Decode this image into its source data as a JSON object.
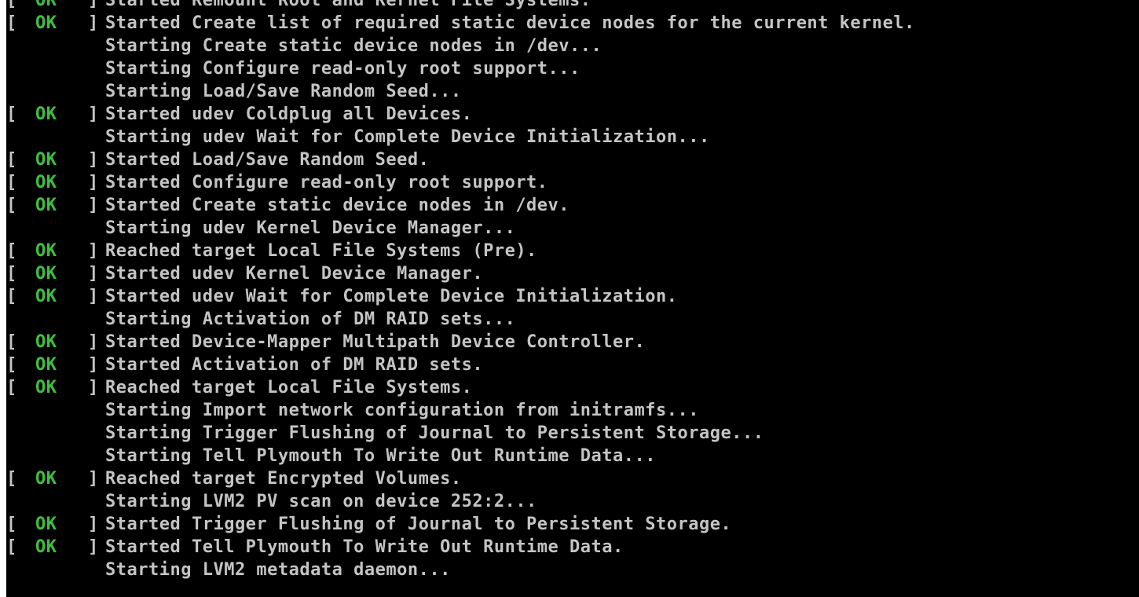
{
  "console": {
    "status_label": "OK",
    "bracket_open": "[",
    "bracket_close": "]",
    "lines": [
      {
        "status": "ok",
        "text": "Started Remount Root and Kernel File Systems."
      },
      {
        "status": "ok",
        "text": "Started Create list of required static device nodes for the current kernel."
      },
      {
        "status": "none",
        "text": "Starting Create static device nodes in /dev..."
      },
      {
        "status": "none",
        "text": "Starting Configure read-only root support..."
      },
      {
        "status": "none",
        "text": "Starting Load/Save Random Seed..."
      },
      {
        "status": "ok",
        "text": "Started udev Coldplug all Devices."
      },
      {
        "status": "none",
        "text": "Starting udev Wait for Complete Device Initialization..."
      },
      {
        "status": "ok",
        "text": "Started Load/Save Random Seed."
      },
      {
        "status": "ok",
        "text": "Started Configure read-only root support."
      },
      {
        "status": "ok",
        "text": "Started Create static device nodes in /dev."
      },
      {
        "status": "none",
        "text": "Starting udev Kernel Device Manager..."
      },
      {
        "status": "ok",
        "text": "Reached target Local File Systems (Pre)."
      },
      {
        "status": "ok",
        "text": "Started udev Kernel Device Manager."
      },
      {
        "status": "ok",
        "text": "Started udev Wait for Complete Device Initialization."
      },
      {
        "status": "none",
        "text": "Starting Activation of DM RAID sets..."
      },
      {
        "status": "ok",
        "text": "Started Device-Mapper Multipath Device Controller."
      },
      {
        "status": "ok",
        "text": "Started Activation of DM RAID sets."
      },
      {
        "status": "ok",
        "text": "Reached target Local File Systems."
      },
      {
        "status": "none",
        "text": "Starting Import network configuration from initramfs..."
      },
      {
        "status": "none",
        "text": "Starting Trigger Flushing of Journal to Persistent Storage..."
      },
      {
        "status": "none",
        "text": "Starting Tell Plymouth To Write Out Runtime Data..."
      },
      {
        "status": "ok",
        "text": "Reached target Encrypted Volumes."
      },
      {
        "status": "none",
        "text": "Starting LVM2 PV scan on device 252:2..."
      },
      {
        "status": "ok",
        "text": "Started Trigger Flushing of Journal to Persistent Storage."
      },
      {
        "status": "ok",
        "text": "Started Tell Plymouth To Write Out Runtime Data."
      },
      {
        "status": "none",
        "text": "Starting LVM2 metadata daemon..."
      }
    ]
  },
  "colors": {
    "background": "#000000",
    "text": "#c4c4c4",
    "ok": "#3fbf3f"
  }
}
